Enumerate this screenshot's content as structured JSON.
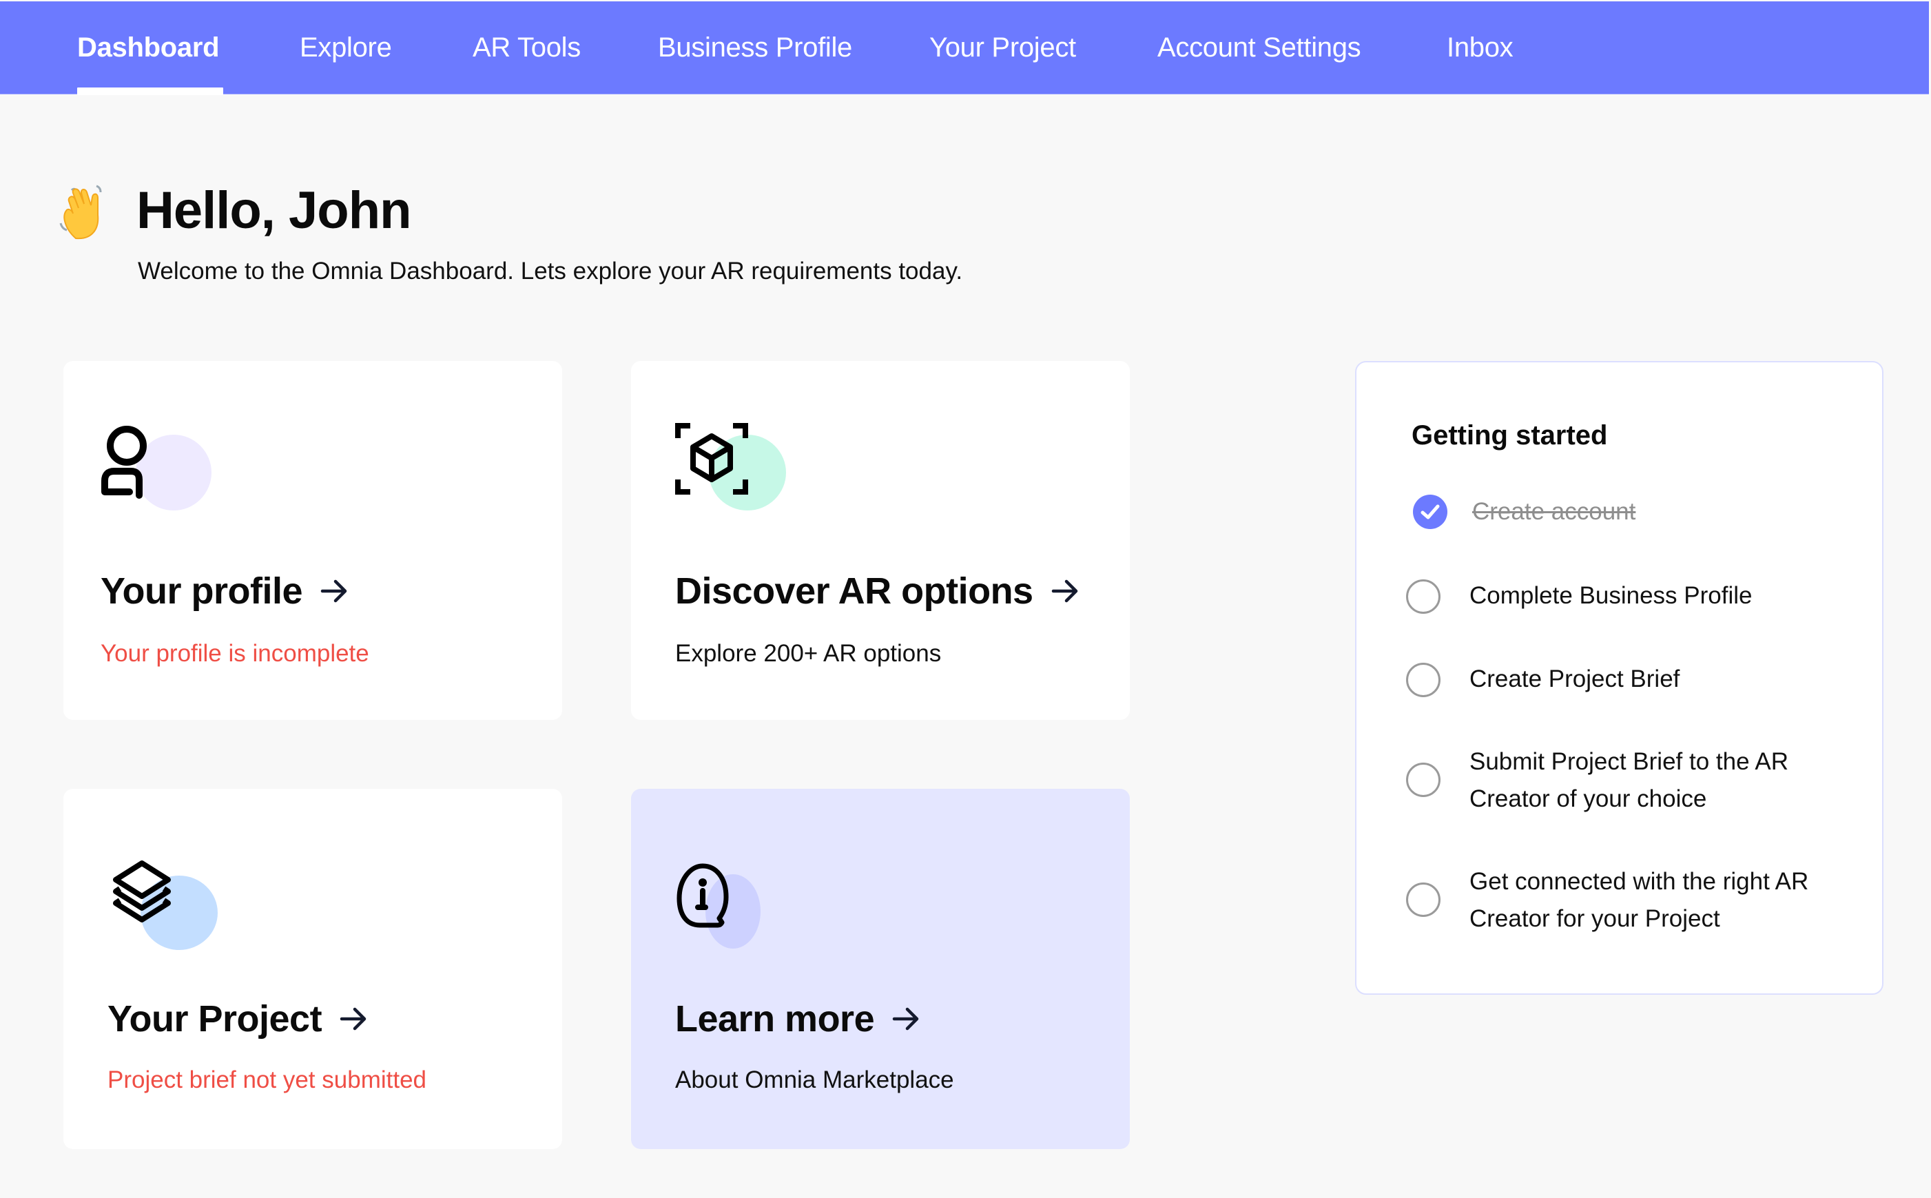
{
  "nav": {
    "items": [
      {
        "label": "Dashboard",
        "active": true
      },
      {
        "label": "Explore",
        "active": false
      },
      {
        "label": "AR Tools",
        "active": false
      },
      {
        "label": "Business Profile",
        "active": false
      },
      {
        "label": "Your Project",
        "active": false
      },
      {
        "label": "Account Settings",
        "active": false
      },
      {
        "label": "Inbox",
        "active": false
      }
    ]
  },
  "greeting": {
    "icon": "waving-hand-icon",
    "title": "Hello, John",
    "subtitle": "Welcome to the Omnia Dashboard. Lets explore your AR requirements today."
  },
  "cards": [
    {
      "icon": "user-icon",
      "title": "Your profile",
      "subtitle": "Your profile is incomplete",
      "status": "warning",
      "blob_color": "#EEEAFF"
    },
    {
      "icon": "ar-cube-icon",
      "title": "Discover AR options",
      "subtitle": "Explore 200+ AR options",
      "status": "info",
      "blob_color": "#C6F8E7"
    },
    {
      "icon": "layers-icon",
      "title": "Your Project",
      "subtitle": "Project brief not yet submitted",
      "status": "warning",
      "blob_color": "#C3DEFF"
    },
    {
      "icon": "info-bubble-icon",
      "title": "Learn more",
      "subtitle": "About Omnia Marketplace",
      "status": "info",
      "blob_color": "#CDD1FF"
    }
  ],
  "getting_started": {
    "title": "Getting started",
    "steps": [
      {
        "label": "Create account",
        "done": true
      },
      {
        "label": "Complete Business Profile",
        "done": false
      },
      {
        "label": "Create Project Brief",
        "done": false
      },
      {
        "label": "Submit Project Brief to the AR Creator of your choice",
        "done": false
      },
      {
        "label": "Get connected with the right AR Creator for your Project",
        "done": false
      }
    ]
  },
  "colors": {
    "accent": "#6C7AFF",
    "warning_text": "#EF4E45",
    "background": "#F8F8F8",
    "highlight_card": "#E4E6FF"
  }
}
